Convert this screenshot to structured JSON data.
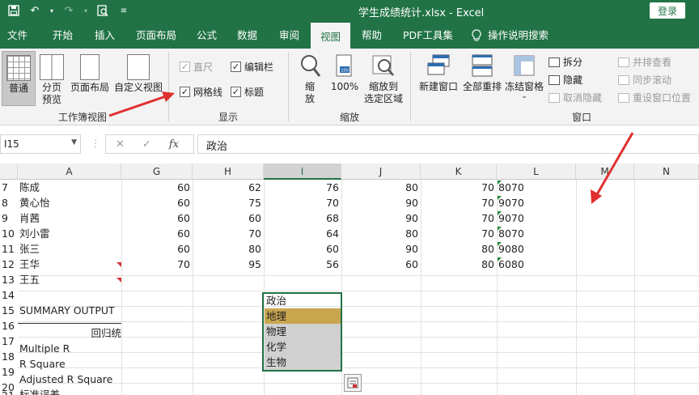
{
  "titlebar": {
    "document_title": "学生成绩统计.xlsx  -  Excel",
    "login_label": "登录",
    "qat_icons": [
      "save-icon",
      "undo-icon",
      "redo-icon",
      "print-preview-icon",
      "customize-qat-icon"
    ]
  },
  "tabs": [
    "文件",
    "开始",
    "插入",
    "页面布局",
    "公式",
    "数据",
    "审阅",
    "视图",
    "帮助",
    "PDF工具集",
    "操作说明搜索"
  ],
  "active_tab": "视图",
  "ribbon": {
    "workbook_views": {
      "label": "工作簿视图",
      "normal": "普通",
      "page_break_line1": "分页",
      "page_break_line2": "预览",
      "page_layout": "页面布局",
      "custom_view": "自定义视图"
    },
    "show": {
      "label": "显示",
      "ruler": "直尺",
      "formula_bar": "编辑栏",
      "gridlines": "网格线",
      "headings": "标题"
    },
    "zoom": {
      "label": "缩放",
      "zoom_line1": "缩",
      "zoom_line2": "放",
      "zoom100": "100%",
      "zoom_selection_line1": "缩放到",
      "zoom_selection_line2": "选定区域"
    },
    "window": {
      "label": "窗口",
      "new_window": "新建窗口",
      "arrange_all": "全部重排",
      "freeze_panes": "冻结窗格",
      "split": "拆分",
      "hide": "隐藏",
      "unhide": "取消隐藏",
      "view_side_by_side": "并排查看",
      "sync_scroll": "同步滚动",
      "reset_position": "重设窗口位置"
    }
  },
  "formula_bar": {
    "name_box": "I15",
    "fx": "fx",
    "content": "政治"
  },
  "sheet": {
    "columns": [
      "A",
      "G",
      "H",
      "I",
      "J",
      "K",
      "L",
      "M",
      "N"
    ],
    "rows": [
      {
        "n": "7",
        "a": "陈成",
        "g": "60",
        "h": "62",
        "i": "76",
        "j": "80",
        "k": "70",
        "l": "8070"
      },
      {
        "n": "8",
        "a": "黄心怡",
        "g": "60",
        "h": "75",
        "i": "70",
        "j": "90",
        "k": "70",
        "l": "9070"
      },
      {
        "n": "9",
        "a": "肖茜",
        "g": "60",
        "h": "60",
        "i": "68",
        "j": "90",
        "k": "70",
        "l": "9070"
      },
      {
        "n": "10",
        "a": "刘小雷",
        "g": "60",
        "h": "70",
        "i": "64",
        "j": "80",
        "k": "70",
        "l": "8070"
      },
      {
        "n": "11",
        "a": "张三",
        "g": "60",
        "h": "80",
        "i": "60",
        "j": "90",
        "k": "80",
        "l": "9080"
      },
      {
        "n": "12",
        "a": "王华",
        "g": "70",
        "h": "95",
        "i": "56",
        "j": "60",
        "k": "80",
        "l": "6080"
      },
      {
        "n": "13",
        "a": "王五"
      },
      {
        "n": "14",
        "a": ""
      },
      {
        "n": "15",
        "a": "SUMMARY OUTPUT",
        "i": "政治"
      },
      {
        "n": "16",
        "a": "",
        "i": "地理"
      },
      {
        "n": "17",
        "a": "回归统",
        "i": "物理"
      },
      {
        "n": "18",
        "a": "Multiple R",
        "i": "化学"
      },
      {
        "n": "19",
        "a": "R Square",
        "i": "生物"
      },
      {
        "n": "20",
        "a": "Adjusted R Square"
      },
      {
        "n": "21",
        "a": "标准误差"
      }
    ],
    "highlight_color": "#c9a54e",
    "selection_color": "#217346"
  },
  "colors": {
    "brand_green": "#217346",
    "ribbon_bg": "#f3f3f3",
    "annotation_red": "#e03030"
  }
}
